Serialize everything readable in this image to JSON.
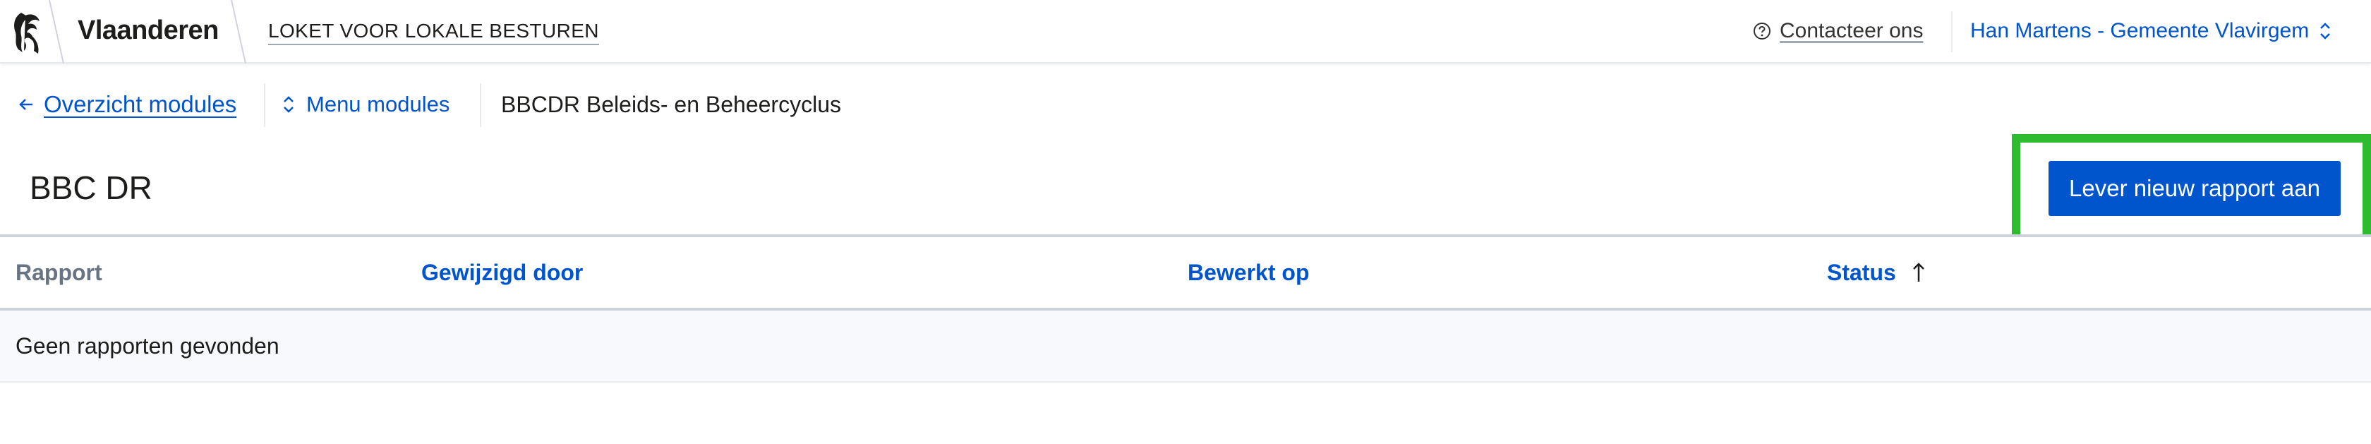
{
  "header": {
    "brand": "Vlaanderen",
    "app_name": "LOKET VOOR LOKALE BESTUREN",
    "contact_label": "Contacteer ons",
    "user_label": "Han Martens - Gemeente Vlavirgem"
  },
  "subnav": {
    "back_label": "Overzicht modules",
    "menu_label": "Menu modules",
    "current": "BBCDR Beleids- en Beheercyclus"
  },
  "page": {
    "title": "BBC DR",
    "primary_button": "Lever nieuw rapport aan"
  },
  "table": {
    "columns": [
      "Rapport",
      "Gewijzigd door",
      "Bewerkt op",
      "Status"
    ],
    "sorted_column": "Status",
    "sort_direction": "ascending",
    "empty_message": "Geen rapporten gevonden"
  },
  "colors": {
    "link": "#0055cc",
    "primary": "#0055cc",
    "highlight": "#2fbb2f"
  }
}
